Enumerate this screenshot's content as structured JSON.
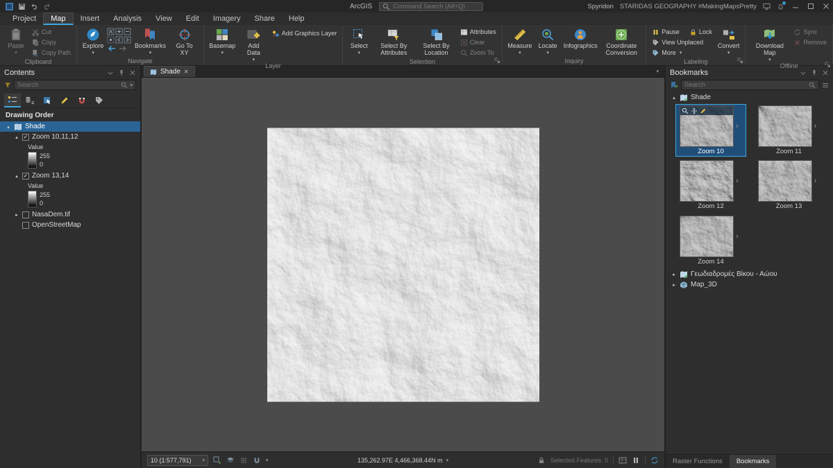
{
  "titlebar": {
    "app": "ArcGIS",
    "search_placeholder": "Command Search (Alt+Q)",
    "user": "Spyridon",
    "project": "STARIDAS GEOGRAPHY #MakingMapsPretty"
  },
  "ribbon": {
    "tabs": [
      "Project",
      "Map",
      "Insert",
      "Analysis",
      "View",
      "Edit",
      "Imagery",
      "Share",
      "Help"
    ],
    "active_tab": "Map",
    "clipboard": {
      "label": "Clipboard",
      "paste": "Paste",
      "cut": "Cut",
      "copy": "Copy",
      "copy_path": "Copy Path"
    },
    "navigate": {
      "label": "Navigate",
      "explore": "Explore",
      "bookmarks": "Bookmarks",
      "go_to_xy": "Go To XY"
    },
    "layer": {
      "label": "Layer",
      "basemap": "Basemap",
      "add_data": "Add Data",
      "add_graphics_layer": "Add Graphics Layer"
    },
    "selection": {
      "label": "Selection",
      "select": "Select",
      "select_by_attributes": "Select By Attributes",
      "select_by_location": "Select By Location",
      "attributes": "Attributes",
      "clear": "Clear",
      "zoom_to": "Zoom To"
    },
    "inquiry": {
      "label": "Inquiry",
      "measure": "Measure",
      "locate": "Locate",
      "infographics": "Infographics",
      "coordinate_conversion": "Coordinate Conversion"
    },
    "labeling": {
      "label": "Labeling",
      "pause": "Pause",
      "lock": "Lock",
      "view_unplaced": "View Unplaced",
      "more": "More",
      "convert": "Convert"
    },
    "offline": {
      "label": "Offline",
      "download_map": "Download Map",
      "sync": "Sync",
      "remove": "Remove"
    }
  },
  "contents": {
    "title": "Contents",
    "search_placeholder": "Search",
    "drawing_order": "Drawing Order",
    "map_name": "Shade",
    "layers": [
      {
        "name": "Zoom 10,11,12",
        "legend_label": "Value",
        "legend_max": "255",
        "legend_min": "0"
      },
      {
        "name": "Zoom 13,14",
        "legend_label": "Value",
        "legend_max": "255",
        "legend_min": "0"
      },
      {
        "name": "NasaDem.tif"
      },
      {
        "name": "OpenStreetMap"
      }
    ]
  },
  "map": {
    "tab": "Shade",
    "scale": "10 (1:577,791)",
    "coordinates": "135,262.97E 4,466,368.44N m",
    "selected_features": "Selected Features: 0"
  },
  "bookmarks": {
    "title": "Bookmarks",
    "search_placeholder": "Search",
    "group": "Shade",
    "items": [
      {
        "label": "Zoom 10"
      },
      {
        "label": "Zoom 11"
      },
      {
        "label": "Zoom 12"
      },
      {
        "label": "Zoom 13"
      },
      {
        "label": "Zoom 14"
      }
    ],
    "selected": "Zoom 10",
    "maps": [
      "Γεωδιαδρομές Βίκου - Αώου",
      "Map_3D"
    ],
    "tabs": [
      "Raster Functions",
      "Bookmarks"
    ],
    "active_tab": "Bookmarks"
  }
}
